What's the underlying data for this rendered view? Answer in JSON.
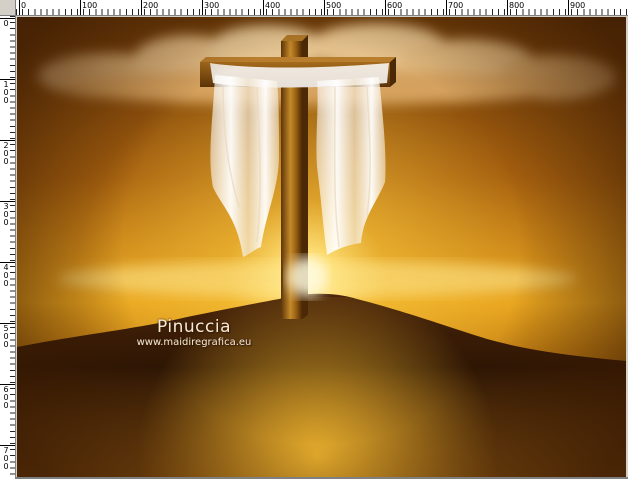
{
  "ruler": {
    "horizontal_labels": [
      "0",
      "100",
      "200",
      "300",
      "400",
      "500",
      "600",
      "700",
      "800",
      "900"
    ],
    "vertical_labels": [
      "0",
      "100",
      "200",
      "300",
      "400",
      "500",
      "600",
      "700"
    ],
    "unit": "px"
  },
  "canvas": {
    "image_description_free": true,
    "watermark": {
      "name": "Pinuccia",
      "url": "www.maidiregrafica.eu"
    },
    "colors": {
      "sky_top": "#6b3a08",
      "sky_glow": "#f6c23a",
      "sun_core": "#fff6c8",
      "hill": "#3b1d05",
      "cross_wood": "#8a5513",
      "cloth": "#fbf6ee"
    }
  }
}
